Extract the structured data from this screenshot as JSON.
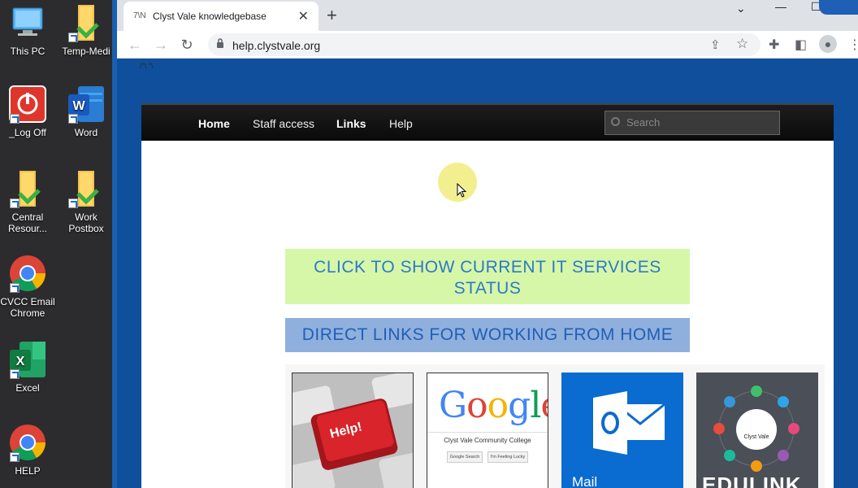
{
  "desktop": {
    "icons": [
      {
        "label": "This PC",
        "icon": "monitor-icon"
      },
      {
        "label": "Temp-Medi",
        "icon": "folder-icon"
      },
      {
        "label": "_Log Off",
        "icon": "power-icon"
      },
      {
        "label": "Word",
        "icon": "word-icon"
      },
      {
        "label": "Central Resour...",
        "icon": "folder-icon"
      },
      {
        "label": "Work Postbox",
        "icon": "folder-icon"
      },
      {
        "label": "CVCC Email Chrome",
        "icon": "chrome-icon"
      },
      {
        "label": "Excel",
        "icon": "excel-icon"
      },
      {
        "label": "HELP",
        "icon": "chrome-icon"
      }
    ]
  },
  "browser": {
    "tab_title": "Clyst Vale knowledgebase",
    "favicon_text": "7\\N",
    "url": "help.clystvale.org"
  },
  "page": {
    "top_glyph": "/\"\\ \"\\",
    "menu": [
      "Home",
      "Staff access",
      "Links",
      "Help"
    ],
    "search_placeholder": "Search",
    "status_button": "CLICK TO SHOW CURRENT IT SERVICES STATUS",
    "links_button": "DIRECT LINKS FOR WORKING FROM HOME",
    "tiles": {
      "help_key": "Help!",
      "google_logo": "Google",
      "google_uk": "UK",
      "google_org": "Clyst Vale Community College",
      "google_search": "Google Search",
      "google_lucky": "I'm Feeling Lucky",
      "mail": "Mail",
      "edulink_center": "Clyst Vale",
      "edulink": "EDULINK"
    }
  },
  "colors": {
    "page_blue": "#0f4f9c",
    "status_bg": "#d6f7a8",
    "links_bg": "#8fb0dd",
    "link_text": "#2d79c8",
    "menubar": "#111111"
  }
}
